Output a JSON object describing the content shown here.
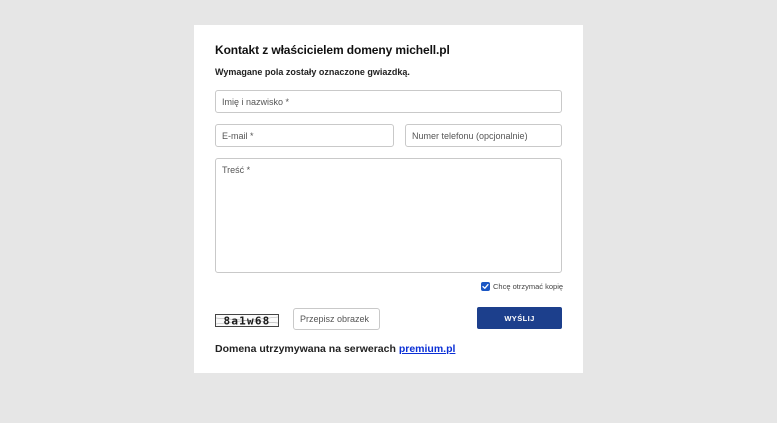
{
  "form": {
    "title": "Kontakt z właścicielem domeny michell.pl",
    "subtitle": "Wymagane pola zostały oznaczone gwiazdką.",
    "name_placeholder": "Imię i nazwisko *",
    "email_placeholder": "E-mail *",
    "phone_placeholder": "Numer telefonu (opcjonalnie)",
    "message_placeholder": "Treść *",
    "copy_checkbox_label": "Chcę otrzymać kopię",
    "copy_checkbox_checked": true,
    "captcha_text": "8a1w68",
    "captcha_placeholder": "Przepisz obrazek",
    "send_label": "WYŚLIJ"
  },
  "footer": {
    "text": "Domena utrzymywana na serwerach ",
    "link_label": "premium.pl"
  },
  "colors": {
    "background": "#e6e6e6",
    "card": "#ffffff",
    "button": "#1c3f8c",
    "checkbox": "#1a56c4",
    "link": "#0a2fd6"
  }
}
